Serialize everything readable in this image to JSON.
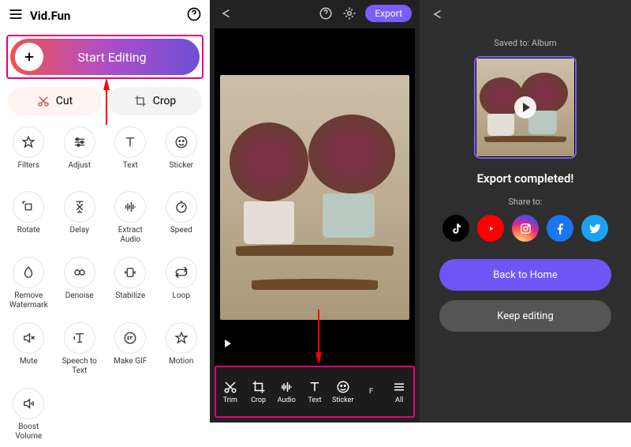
{
  "panel1": {
    "app_title": "Vid.Fun",
    "start_label": "Start Editing",
    "quick": {
      "cut": "Cut",
      "crop": "Crop"
    },
    "tools": [
      {
        "key": "filters",
        "label": "Filters"
      },
      {
        "key": "adjust",
        "label": "Adjust"
      },
      {
        "key": "text",
        "label": "Text"
      },
      {
        "key": "sticker",
        "label": "Sticker"
      },
      {
        "key": "rotate",
        "label": "Rotate"
      },
      {
        "key": "delay",
        "label": "Delay"
      },
      {
        "key": "extract",
        "label": "Extract\nAudio"
      },
      {
        "key": "speed",
        "label": "Speed"
      },
      {
        "key": "rmwm",
        "label": "Remove\nWatermark"
      },
      {
        "key": "denoise",
        "label": "Denoise"
      },
      {
        "key": "stabilize",
        "label": "Stabilize"
      },
      {
        "key": "loop",
        "label": "Loop"
      },
      {
        "key": "mute",
        "label": "Mute"
      },
      {
        "key": "stt",
        "label": "Speech to\nText"
      },
      {
        "key": "gif",
        "label": "Make GIF"
      },
      {
        "key": "motion",
        "label": "Motion"
      },
      {
        "key": "boost",
        "label": "Boost\nVolume"
      }
    ]
  },
  "panel2": {
    "export_label": "Export",
    "bottom": [
      {
        "key": "trim",
        "label": "Trim"
      },
      {
        "key": "crop",
        "label": "Crop"
      },
      {
        "key": "audio",
        "label": "Audio"
      },
      {
        "key": "text",
        "label": "Text"
      },
      {
        "key": "sticker",
        "label": "Sticker"
      },
      {
        "key": "f",
        "label": "F"
      },
      {
        "key": "all",
        "label": "All"
      }
    ]
  },
  "panel3": {
    "saved_to": "Saved to: Album",
    "export_done": "Export completed!",
    "share_to": "Share to:",
    "socials": [
      "tiktok",
      "youtube",
      "instagram",
      "facebook",
      "twitter"
    ],
    "back_home": "Back to Home",
    "keep_editing": "Keep editing"
  }
}
